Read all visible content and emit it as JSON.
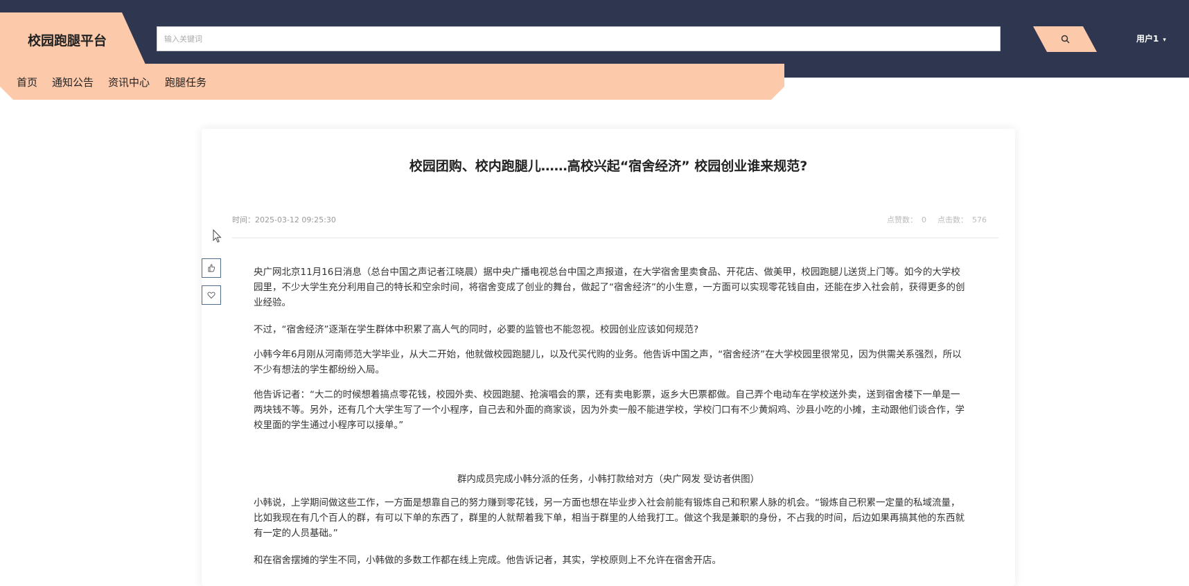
{
  "header": {
    "logo": "校园跑腿平台",
    "search": {
      "placeholder": "输入关键词",
      "value": ""
    },
    "search_icon": "search-icon",
    "user": {
      "name": "用户1",
      "caret": "▾"
    }
  },
  "nav": {
    "items": [
      {
        "label": "首页"
      },
      {
        "label": "通知公告"
      },
      {
        "label": "资讯中心"
      },
      {
        "label": "跑腿任务"
      }
    ]
  },
  "article": {
    "title": "校园团购、校内跑腿儿……高校兴起“宿舍经济” 校园创业谁来规范?",
    "time": "时间：2025-03-12 09:25:30",
    "likes_label": "点赞数：",
    "likes": "0",
    "clicks_label": "点击数：",
    "clicks": "576",
    "actions": [
      {
        "icon": "thumbs-up-icon"
      },
      {
        "icon": "heart-icon"
      }
    ],
    "paragraphs": [
      "央广网北京11月16日消息（总台中国之声记者江晓晨）据中央广播电视总台中国之声报道，在大学宿舍里卖食品、开花店、做美甲，校园跑腿儿送货上门等。如今的大学校园里，不少大学生充分利用自己的特长和空余时间，将宿舍变成了创业的舞台，做起了“宿舍经济”的小生意，一方面可以实现零花钱自由，还能在步入社会前，获得更多的创业经验。",
      "不过，“宿舍经济”逐渐在学生群体中积累了高人气的同时，必要的监管也不能忽视。校园创业应该如何规范?",
      "小韩今年6月刚从河南师范大学毕业，从大二开始，他就做校园跑腿儿，以及代买代购的业务。他告诉中国之声，“宿舍经济”在大学校园里很常见，因为供需关系强烈，所以不少有想法的学生都纷纷入局。",
      "他告诉记者：“大二的时候想着搞点零花钱，校园外卖、校园跑腿、抢演唱会的票，还有卖电影票，返乡大巴票都做。自己弄个电动车在学校送外卖，送到宿舍楼下一单是一两块钱不等。另外，还有几个大学生写了一个小程序，自己去和外面的商家谈，因为外卖一般不能进学校，学校门口有不少黄焖鸡、沙县小吃的小摊，主动跟他们谈合作，学校里面的学生通过小程序可以接单。”",
      "小韩说，上学期间做这些工作，一方面是想靠自己的努力赚到零花钱，另一方面也想在毕业步入社会前能有锻炼自己和积累人脉的机会。“锻炼自己积累一定量的私域流量，比如我现在有几个百人的群，有可以下单的东西了，群里的人就帮着我下单，相当于群里的人给我打工。做这个我是兼职的身份，不占我的时间，后边如果再搞其他的东西就有一定的人员基础。”",
      "和在宿舍摆摊的学生不同，小韩做的多数工作都在线上完成。他告诉记者，其实，学校原则上不允许在宿舍开店。"
    ],
    "caption": "群内成员完成小韩分派的任务，小韩打款给对方（央广网发 受访者供图）"
  },
  "colors": {
    "topbar": "#2f3650",
    "accent": "#fcc9ab",
    "side_button_border": "#4e6d8c"
  }
}
